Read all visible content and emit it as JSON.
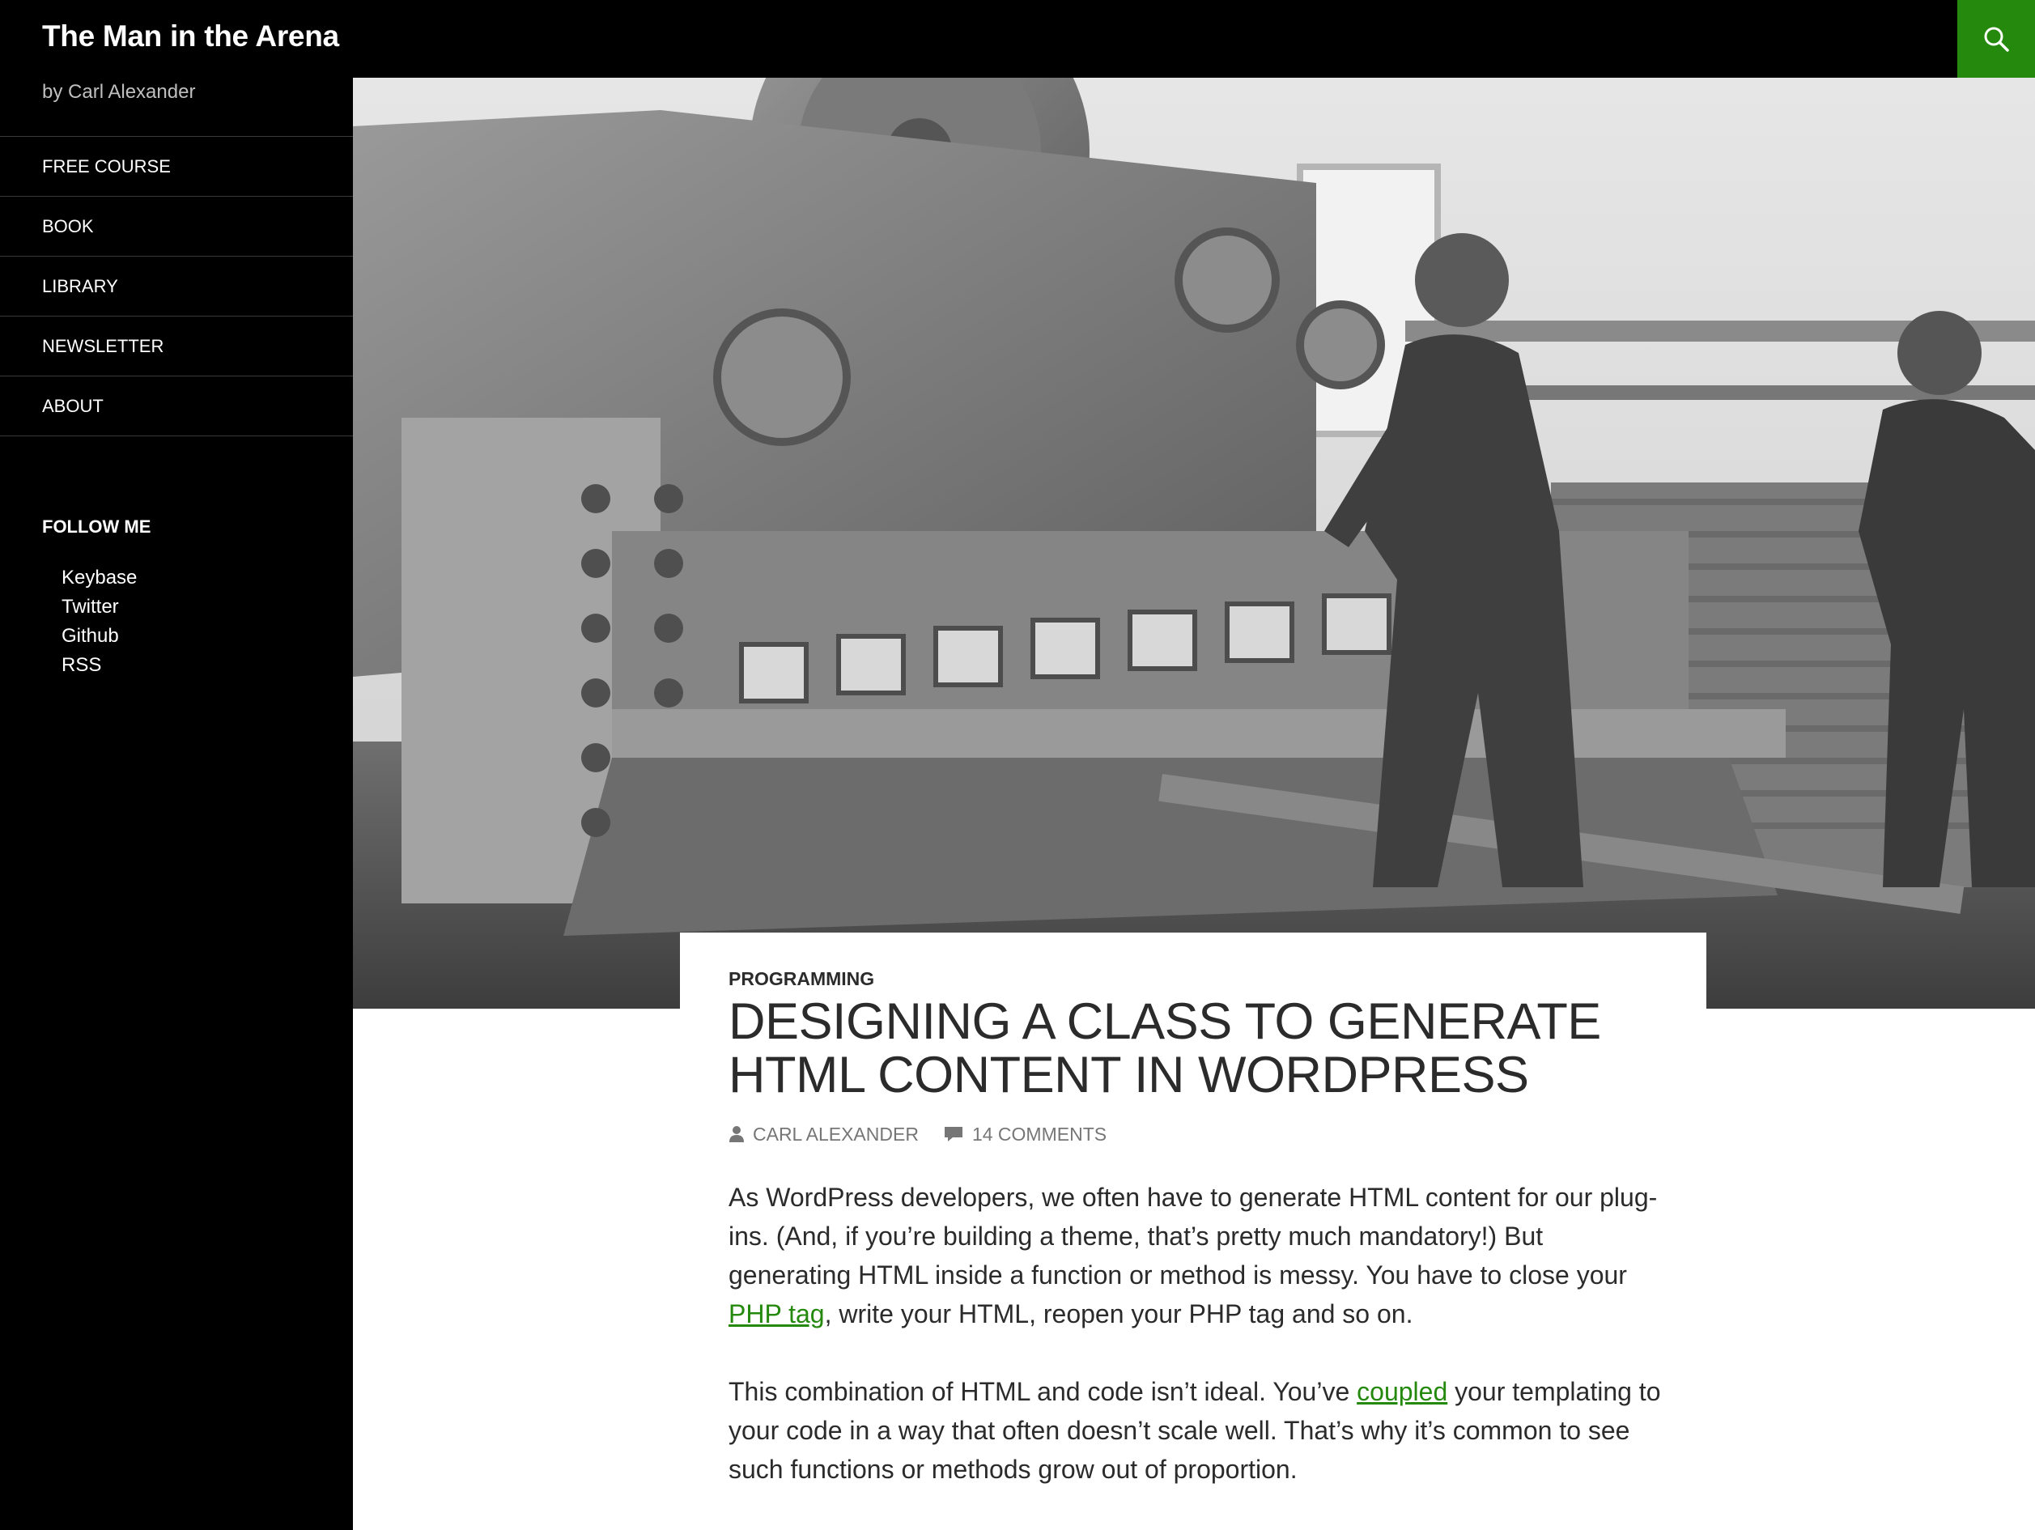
{
  "site": {
    "title": "The Man in the Arena",
    "description": "by Carl Alexander"
  },
  "nav": {
    "items": [
      {
        "label": "Free Course"
      },
      {
        "label": "Book"
      },
      {
        "label": "Library"
      },
      {
        "label": "Newsletter"
      },
      {
        "label": "About"
      }
    ]
  },
  "sidebar_widget": {
    "title": "Follow Me",
    "links": [
      {
        "label": "Keybase"
      },
      {
        "label": "Twitter"
      },
      {
        "label": "Github"
      },
      {
        "label": "RSS"
      }
    ]
  },
  "icons": {
    "search": "search-icon",
    "author": "user-icon",
    "comments": "comment-icon"
  },
  "colors": {
    "accent": "#24890d",
    "background_dark": "#000000",
    "text": "#2b2b2b",
    "meta": "#767676"
  },
  "post": {
    "category": "Programming",
    "title": "Designing a class to generate HTML content in WordPress",
    "author": "Carl Alexander",
    "comments": "14 Comments",
    "paragraph1": {
      "before_link": "As WordPress developers, we often have to generate HTML content for our plug-ins. (And, if you’re building a theme, that’s pretty much mandatory!) But generating HTML inside a function or method is messy. You have to close your ",
      "link": "PHP tag",
      "after_link": ", write your HTML, reopen your PHP tag and so on."
    },
    "paragraph2": {
      "before_link": "This combination of HTML and code isn’t ideal. You’ve ",
      "link": "coupled",
      "after_link": " your templating to your code in a way that often doesn’t scale well. That’s why it’s common to see such functions or methods grow out of proportion."
    }
  }
}
